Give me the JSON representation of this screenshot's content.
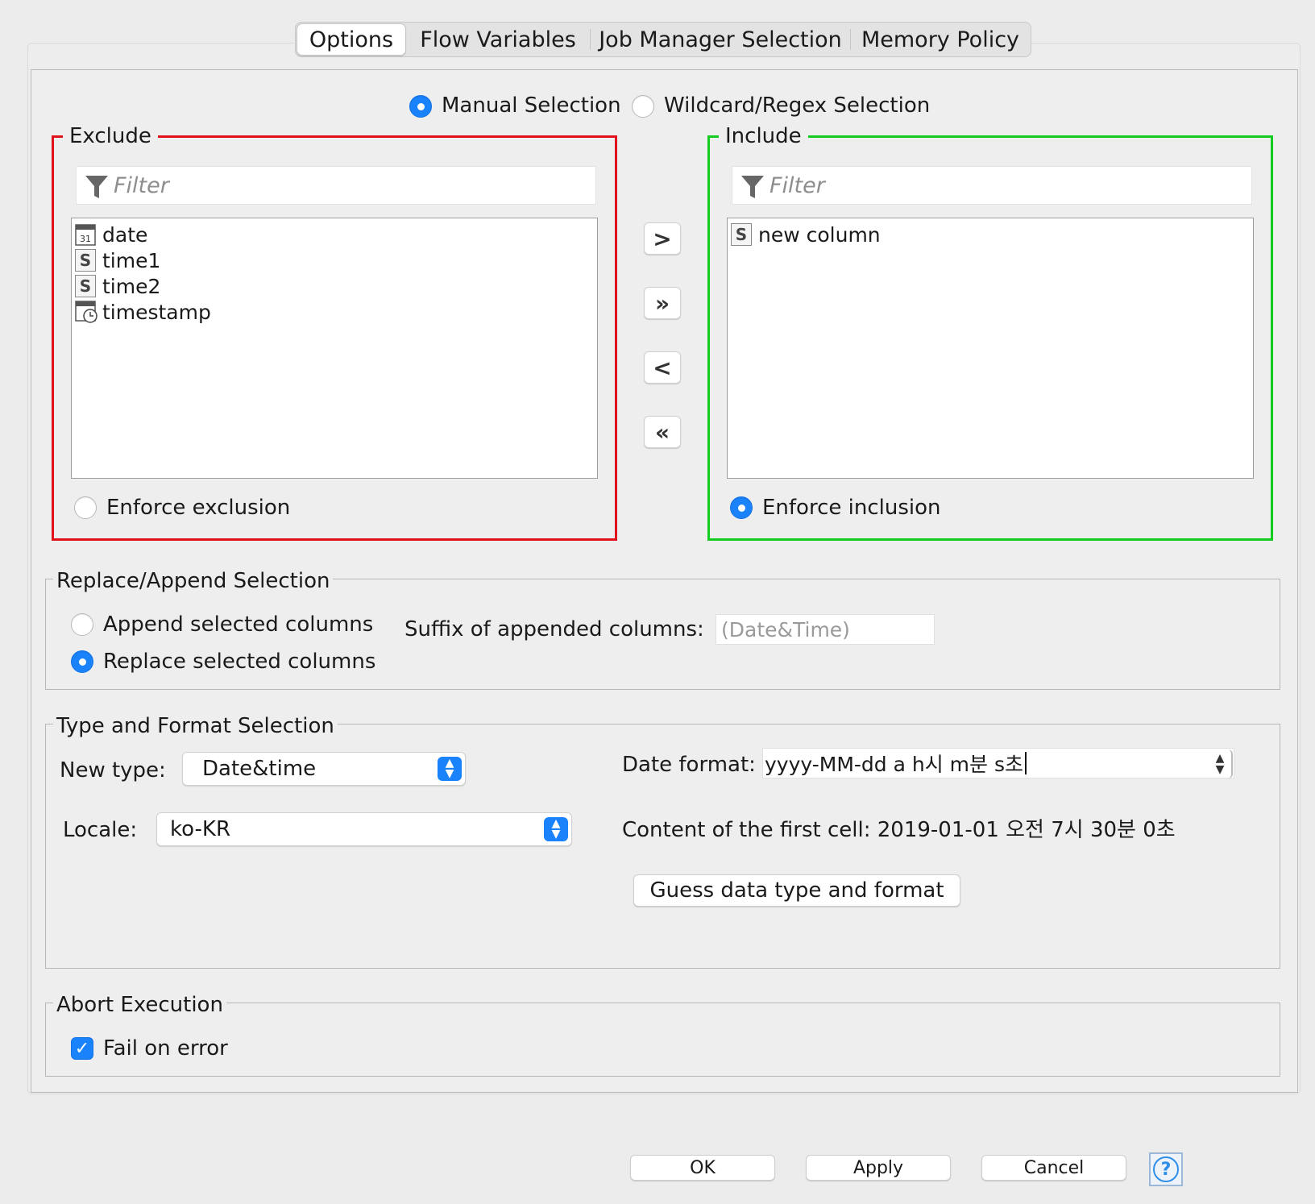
{
  "tabs": [
    {
      "label": "Options",
      "active": true
    },
    {
      "label": "Flow Variables",
      "active": false
    },
    {
      "label": "Job Manager Selection",
      "active": false
    },
    {
      "label": "Memory Policy",
      "active": false
    }
  ],
  "selection_mode": {
    "manual_label": "Manual Selection",
    "wildcard_label": "Wildcard/Regex Selection",
    "selected": "manual"
  },
  "exclude": {
    "title": "Exclude",
    "filter_placeholder": "Filter",
    "items": [
      {
        "icon": "calendar-icon",
        "badge": "31",
        "label": "date"
      },
      {
        "icon": "string-type-icon",
        "badge": "S",
        "label": "time1"
      },
      {
        "icon": "string-type-icon",
        "badge": "S",
        "label": "time2"
      },
      {
        "icon": "datetime-icon",
        "badge": "",
        "label": "timestamp"
      }
    ],
    "enforce_label": "Enforce exclusion",
    "enforce_selected": false
  },
  "include": {
    "title": "Include",
    "filter_placeholder": "Filter",
    "items": [
      {
        "icon": "string-type-icon",
        "badge": "S",
        "label": "new column"
      }
    ],
    "enforce_label": "Enforce inclusion",
    "enforce_selected": true
  },
  "move_buttons": {
    "add": ">",
    "add_all": "»",
    "remove": "<",
    "remove_all": "«"
  },
  "replace_append": {
    "title": "Replace/Append Selection",
    "append_label": "Append selected columns",
    "replace_label": "Replace selected columns",
    "selected": "replace",
    "suffix_label": "Suffix of appended columns:",
    "suffix_value": "(Date&Time)"
  },
  "type_format": {
    "title": "Type and Format Selection",
    "new_type_label": "New type:",
    "new_type_value": "Date&time",
    "date_format_label": "Date format:",
    "date_format_value": "yyyy-MM-dd a h시 m분 s초",
    "locale_label": "Locale:",
    "locale_value": "ko-KR",
    "first_cell_text": "Content of the first cell: 2019-01-01 오전 7시 30분 0초",
    "guess_button": "Guess data type and format"
  },
  "abort": {
    "title": "Abort Execution",
    "fail_label": "Fail on error",
    "fail_checked": true
  },
  "footer": {
    "ok": "OK",
    "apply": "Apply",
    "cancel": "Cancel",
    "help": "?"
  },
  "colors": {
    "accent": "#1a82fb",
    "exclude_border": "#e0111b",
    "include_border": "#12cc1f"
  }
}
